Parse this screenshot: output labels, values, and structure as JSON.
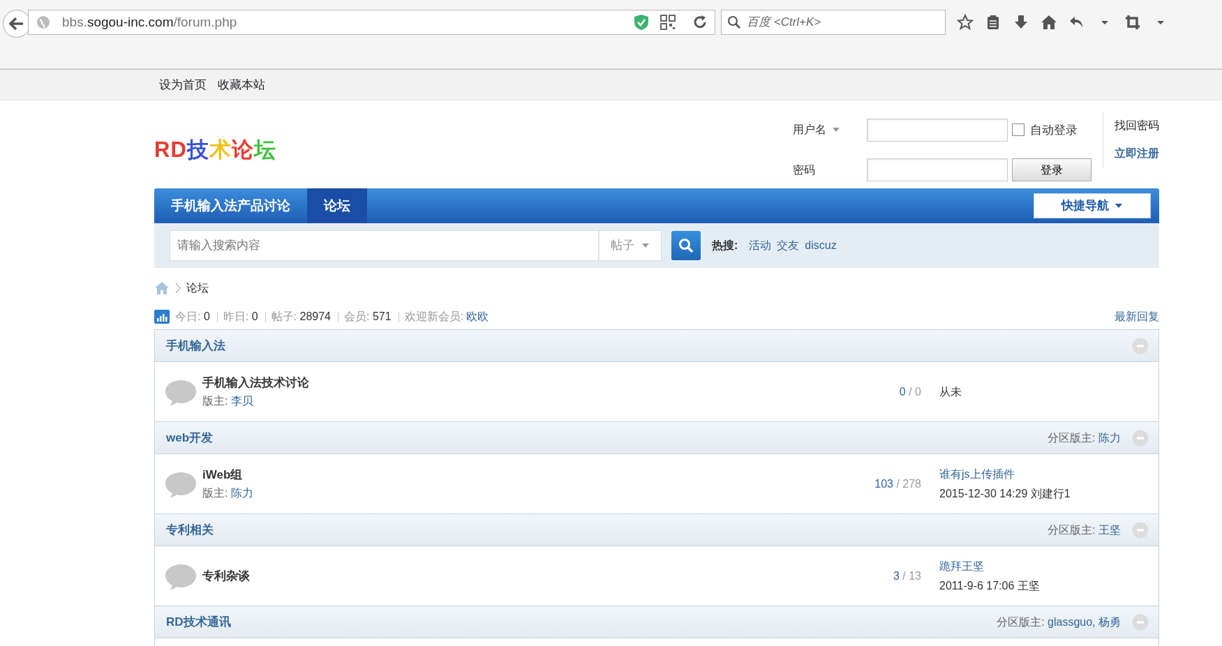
{
  "browser": {
    "url_parts": [
      {
        "text": "bbs.",
        "strong": false
      },
      {
        "text": "sogou-inc.com",
        "strong": true
      },
      {
        "text": "/forum.php",
        "strong": false
      }
    ],
    "search_placeholder": "百度 <Ctrl+K>"
  },
  "topbar": {
    "links": [
      "设为首页",
      "收藏本站"
    ]
  },
  "logo": [
    {
      "text": "RD",
      "color": "#e8392f"
    },
    {
      "text": "技",
      "color": "#3b4fd8"
    },
    {
      "text": "术",
      "color": "#f2c21a"
    },
    {
      "text": "论",
      "color": "#e8392f"
    },
    {
      "text": "坛",
      "color": "#3cbf3c"
    }
  ],
  "login": {
    "username_label": "用户名",
    "password_label": "密码",
    "auto_login": {
      "label": "自动登录",
      "checked": false
    },
    "login_button": "登录",
    "forgot": "找回密码",
    "register": "立即注册"
  },
  "nav": {
    "items": [
      {
        "label": "手机输入法产品讨论",
        "selected": false
      },
      {
        "label": "论坛",
        "selected": true
      }
    ],
    "quick_nav": "快捷导航"
  },
  "search": {
    "placeholder": "请输入搜索内容",
    "type": "帖子",
    "hot_label": "热搜:",
    "hot": [
      "活动",
      "交友",
      "discuz"
    ]
  },
  "breadcrumb": [
    "论坛"
  ],
  "stats": [
    {
      "label": "今日:",
      "value": "0",
      "kind": "number"
    },
    {
      "label": "昨日:",
      "value": "0",
      "kind": "number"
    },
    {
      "label": "帖子:",
      "value": "28974",
      "kind": "number"
    },
    {
      "label": "会员:",
      "value": "571",
      "kind": "number"
    },
    {
      "label": "欢迎新会员:",
      "value": "欧欧",
      "kind": "link"
    }
  ],
  "latest_link": "最新回复",
  "sections": [
    {
      "title": "手机输入法",
      "forums": [
        {
          "name": "手机输入法技术讨论",
          "moderator_label": "版主:",
          "moderator": "李贝",
          "today": "0",
          "separator": "/",
          "total": "0",
          "last": {
            "kind": "never",
            "text": "从未"
          }
        }
      ]
    },
    {
      "title": "web开发",
      "moderator_label": "分区版主:",
      "moderators": "陈力",
      "forums": [
        {
          "name": "iWeb组",
          "moderator_label": "版主:",
          "moderator": "陈力",
          "today": "103",
          "separator": "/",
          "total": "278",
          "last": {
            "kind": "post",
            "title": "谁有js上传插件",
            "time": "2015-12-30 14:29",
            "user": "刘建行1"
          }
        }
      ]
    },
    {
      "title": "专利相关",
      "moderator_label": "分区版主:",
      "moderators": "王坚",
      "forums": [
        {
          "name": "专利杂谈",
          "today": "3",
          "separator": "/",
          "total": "13",
          "last": {
            "kind": "post",
            "title": "跪拜王坚",
            "time": "2011-9-6 17:06",
            "user": "王坚"
          }
        }
      ]
    },
    {
      "title": "RD技术通讯",
      "moderator_label": "分区版主:",
      "moderators": "glassguo, 杨勇"
    }
  ]
}
